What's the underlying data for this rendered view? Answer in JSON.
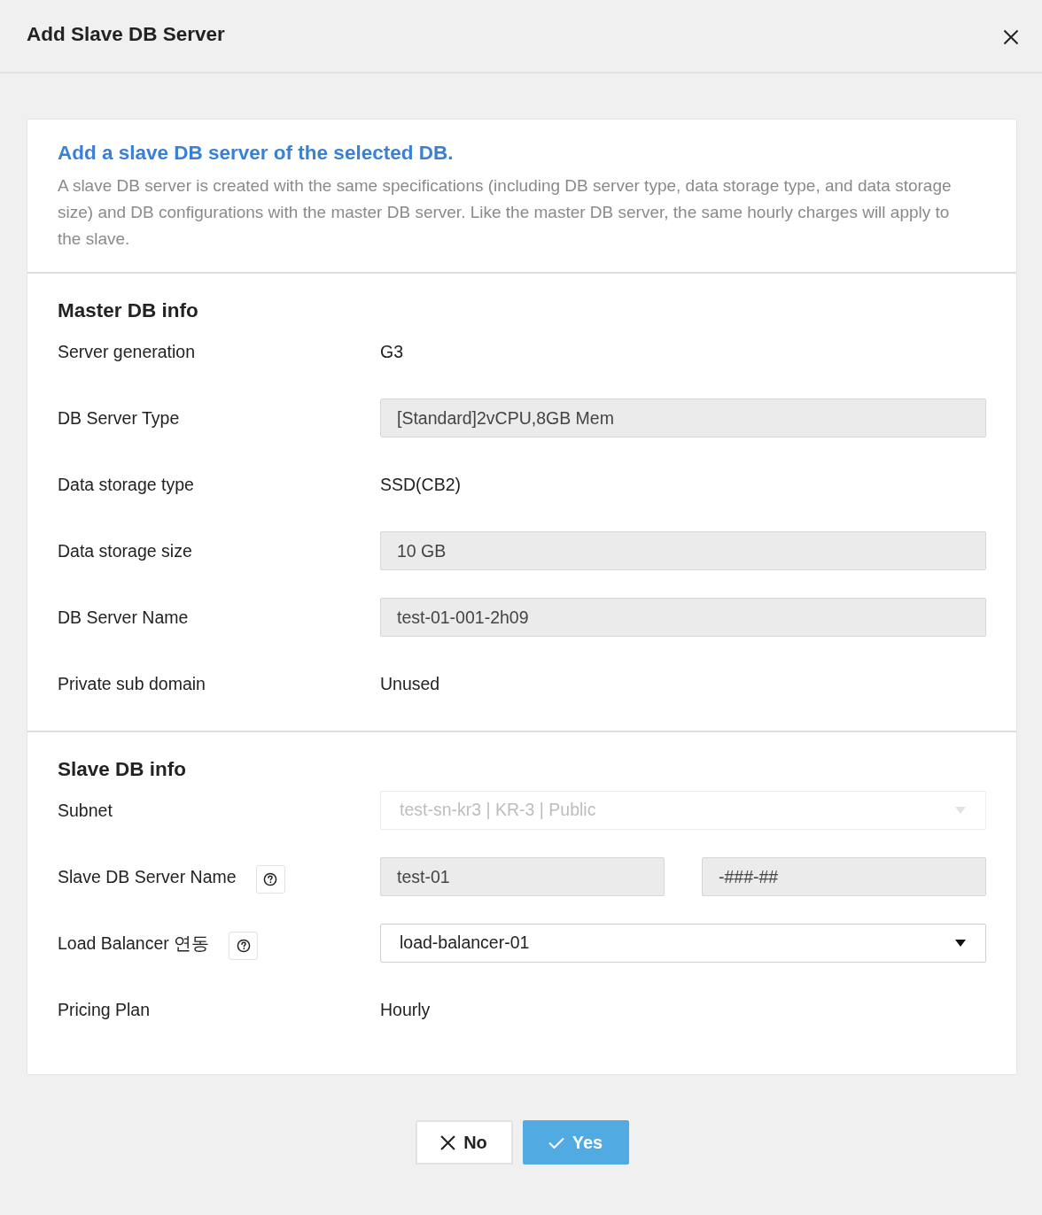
{
  "dialog": {
    "title": "Add Slave DB Server"
  },
  "intro": {
    "heading": "Add a slave DB server of the selected DB.",
    "description": "A slave DB server is created with the same specifications (including DB server type, data storage type, and data storage size) and DB configurations with the master DB server. Like the master DB server, the same hourly charges will apply to the slave."
  },
  "master_info": {
    "title": "Master DB info",
    "rows": [
      {
        "kind": "text",
        "label": "Server generation",
        "value": "G3"
      },
      {
        "kind": "readonly",
        "label": "DB Server Type",
        "value": "[Standard]2vCPU,8GB Mem"
      },
      {
        "kind": "text",
        "label": "Data storage type",
        "value": "SSD(CB2)"
      },
      {
        "kind": "readonly",
        "label": "Data storage size",
        "value": "10 GB"
      },
      {
        "kind": "readonly",
        "label": "DB Server Name",
        "value": "test-01-001-2h09"
      },
      {
        "kind": "text",
        "label": "Private sub domain",
        "value": "Unused"
      }
    ]
  },
  "slave_info": {
    "title": "Slave DB info",
    "rows": [
      {
        "kind": "select",
        "label": "Subnet",
        "help": false,
        "disabled": true,
        "value": "test-sn-kr3 | KR-3 | Public"
      },
      {
        "kind": "split",
        "label": "Slave DB Server Name",
        "help": true,
        "fields": [
          "test-01",
          "-###-##"
        ]
      },
      {
        "kind": "select",
        "label": "Load Balancer 연동",
        "help": true,
        "disabled": false,
        "value": "load-balancer-01"
      },
      {
        "kind": "text",
        "label": "Pricing Plan",
        "help": false,
        "value": "Hourly"
      }
    ]
  },
  "buttons": [
    {
      "kind": "cancel",
      "label": "No"
    },
    {
      "kind": "confirm",
      "label": "Yes"
    }
  ]
}
